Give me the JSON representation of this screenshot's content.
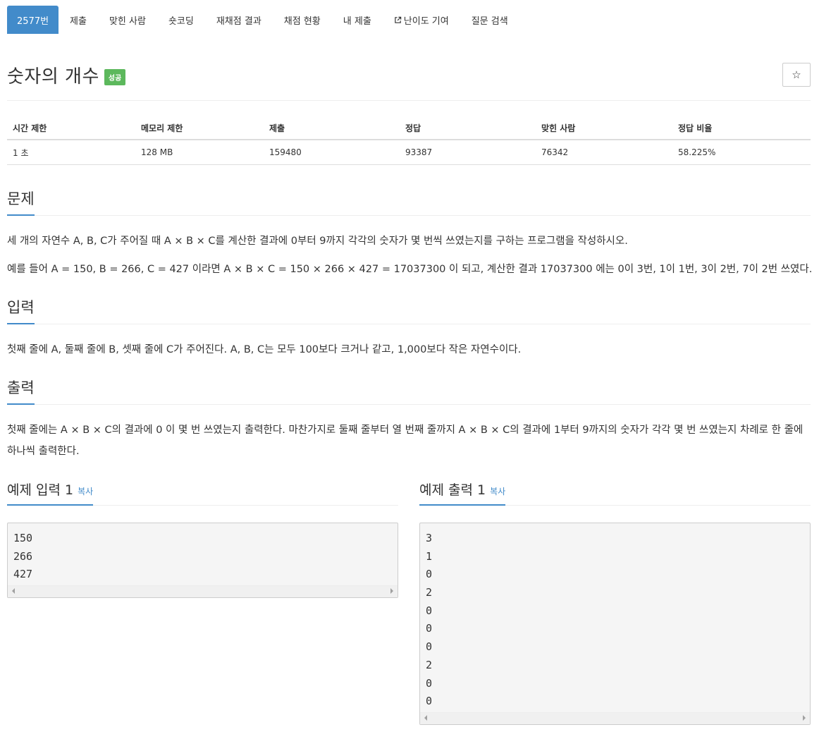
{
  "nav": {
    "tabs": [
      "2577번",
      "제출",
      "맞힌 사람",
      "숏코딩",
      "재채점 결과",
      "채점 현황",
      "내 제출",
      "난이도 기여",
      "질문 검색"
    ]
  },
  "problem": {
    "title": "숫자의 개수",
    "badge": "성공",
    "star_icon": "star-icon"
  },
  "info": {
    "headers": [
      "시간 제한",
      "메모리 제한",
      "제출",
      "정답",
      "맞힌 사람",
      "정답 비율"
    ],
    "values": [
      "1 초",
      "128 MB",
      "159480",
      "93387",
      "76342",
      "58.225%"
    ]
  },
  "sections": {
    "problem": {
      "heading": "문제",
      "p1": "세 개의 자연수 A, B, C가 주어질 때 A × B × C를 계산한 결과에 0부터 9까지 각각의 숫자가 몇 번씩 쓰였는지를 구하는 프로그램을 작성하시오.",
      "p2": "예를 들어 A = 150, B = 266, C = 427 이라면 A × B × C = 150 × 266 × 427 = 17037300 이 되고, 계산한 결과 17037300 에는 0이 3번, 1이 1번, 3이 2번, 7이 2번 쓰였다."
    },
    "input": {
      "heading": "입력",
      "p1": "첫째 줄에 A, 둘째 줄에 B, 셋째 줄에 C가 주어진다. A, B, C는 모두 100보다 크거나 같고, 1,000보다 작은 자연수이다."
    },
    "output": {
      "heading": "출력",
      "p1": "첫째 줄에는 A × B × C의 결과에 0 이 몇 번 쓰였는지 출력한다. 마찬가지로 둘째 줄부터 열 번째 줄까지 A × B × C의 결과에 1부터 9까지의 숫자가 각각 몇 번 쓰였는지 차례로 한 줄에 하나씩 출력한다."
    }
  },
  "samples": {
    "input": {
      "heading": "예제 입력 1",
      "copy": "복사",
      "lines": [
        "150",
        "266",
        "427"
      ]
    },
    "output": {
      "heading": "예제 출력 1",
      "copy": "복사",
      "lines": [
        "3",
        "1",
        "0",
        "2",
        "0",
        "0",
        "0",
        "2",
        "0",
        "0"
      ]
    }
  },
  "colors": {
    "accent": "#428bca",
    "success": "#5cb85c"
  }
}
